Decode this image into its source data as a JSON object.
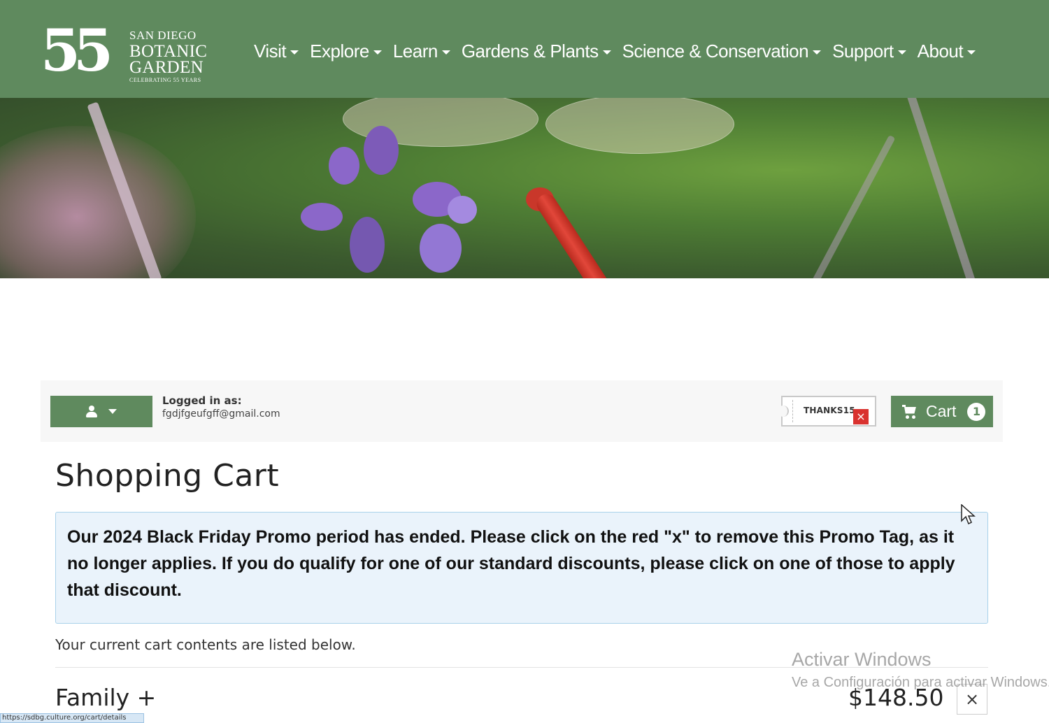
{
  "header": {
    "logo": {
      "number": "55",
      "line1": "SAN DIEGO",
      "line2": "BOTANIC",
      "line3": "GARDEN",
      "line4": "CELEBRATING 55 YEARS"
    },
    "nav": [
      {
        "label": "Visit"
      },
      {
        "label": "Explore"
      },
      {
        "label": "Learn"
      },
      {
        "label": "Gardens & Plants"
      },
      {
        "label": "Science & Conservation"
      },
      {
        "label": "Support"
      },
      {
        "label": "About"
      }
    ],
    "brand_color": "#5f8a5e"
  },
  "account": {
    "logged_in_label": "Logged in as:",
    "email": "fgdjfgeufgff@gmail.com",
    "promo_code": "THANKS15",
    "promo_remove": "×",
    "cart_label": "Cart",
    "cart_count": "1"
  },
  "page": {
    "title": "Shopping Cart",
    "alert": "Our 2024 Black Friday Promo period has ended. Please click on the red \"x\" to remove this Promo Tag, as it no longer applies. If you do qualify for one of our standard discounts, please click on one of those to apply that discount.",
    "intro": "Your current cart contents are listed below."
  },
  "cart_items": [
    {
      "name": "Family +",
      "price": "$148.50",
      "remove": "×"
    }
  ],
  "overlay": {
    "watermark_title": "Activar Windows",
    "watermark_sub": "Ve a Configuración para activar Windows.",
    "status_url": "https://sdbg.culture.org/cart/details"
  },
  "icons": {
    "user": "user-icon",
    "cart": "cart-icon",
    "caret": "caret-down-icon"
  }
}
